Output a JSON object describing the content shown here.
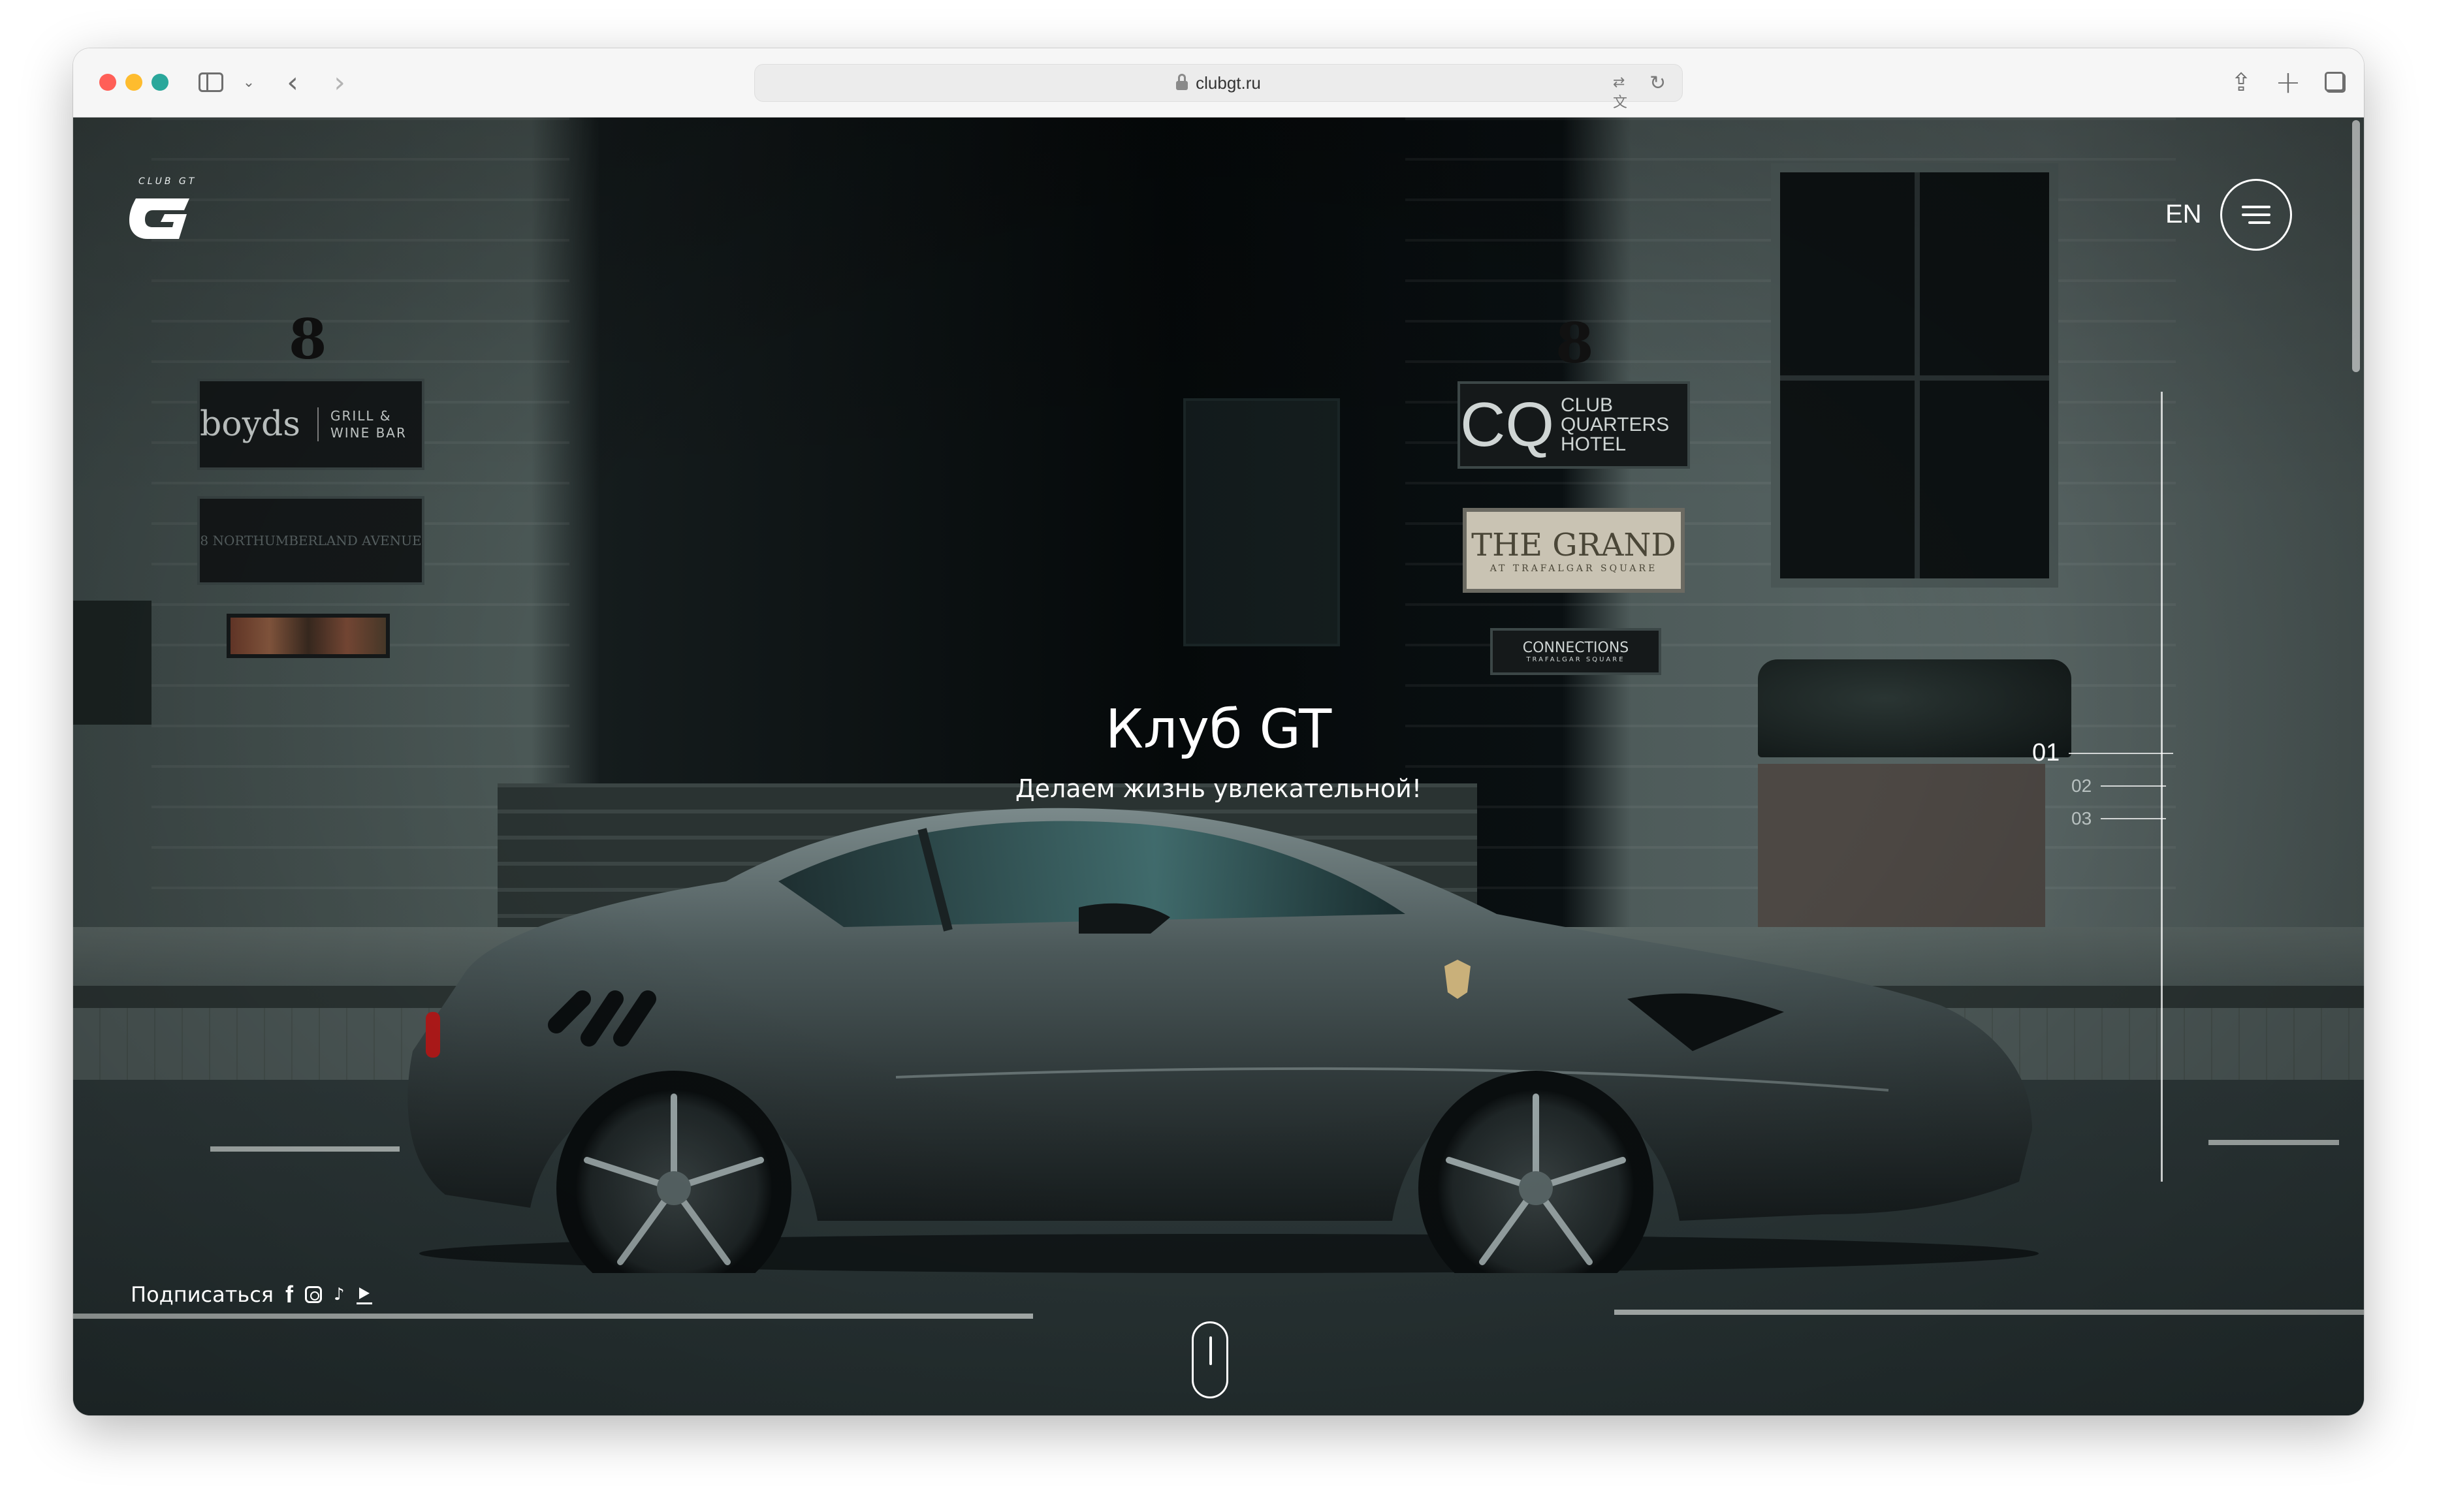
{
  "browser": {
    "url": "clubgt.ru",
    "icons": {
      "sidebar": "sidebar-icon",
      "chevron": "chevron-down-icon",
      "back": "back-arrow-icon",
      "forward": "forward-arrow-icon",
      "lock": "lock-icon",
      "translate": "translate-icon",
      "reload": "reload-icon",
      "share": "share-icon",
      "new_tab": "plus-icon",
      "tabs": "tab-overview-icon"
    },
    "traffic_colors": [
      "#ff5f57",
      "#febc2e",
      "#2aa79b"
    ]
  },
  "site": {
    "logo_text": "CLUB GT",
    "logo_mark": "G",
    "language": "EN",
    "hero": {
      "title": "Клуб GT",
      "subtitle": "Делаем жизнь увлекательной!"
    },
    "slides": [
      {
        "label": "01",
        "active": true
      },
      {
        "label": "02",
        "active": false
      },
      {
        "label": "03",
        "active": false
      }
    ],
    "subscribe_label": "Подписаться",
    "social_icons": [
      "facebook-icon",
      "instagram-icon",
      "tiktok-icon",
      "youtube-icon"
    ],
    "scene_signs": {
      "house_number": "8",
      "boyds": "boyds",
      "boyds_sub": "GRILL & WINE BAR",
      "northumberland": "8 NORTHUMBERLAND AVENUE",
      "cq": "CQ",
      "cq_sub": "CLUB QUARTERS HOTEL",
      "grand": "THE GRAND",
      "grand_sub": "AT TRAFALGAR SQUARE",
      "connections": "CONNECTIONS",
      "connections_sub": "TRAFALGAR SQUARE"
    }
  },
  "colors": {
    "overlay_text": "#ffffff",
    "scene_teal": "#4c5957"
  }
}
